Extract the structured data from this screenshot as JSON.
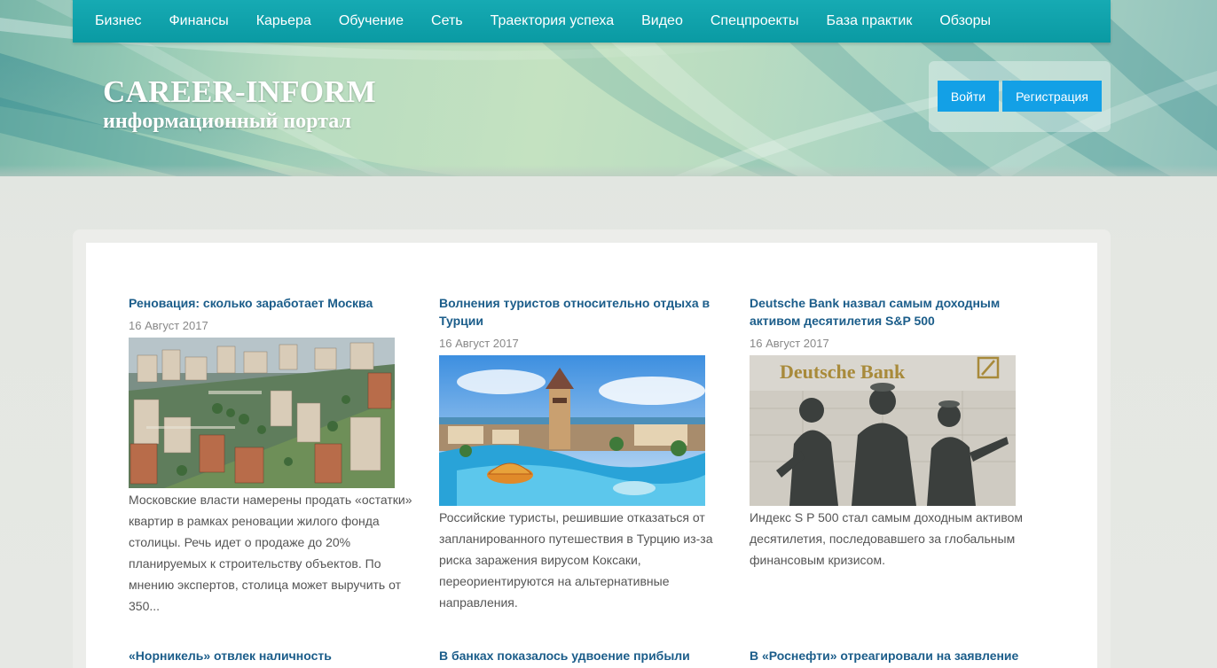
{
  "nav": {
    "items": [
      "Бизнес",
      "Финансы",
      "Карьера",
      "Обучение",
      "Сеть",
      "Траектория успеха",
      "Видео",
      "Спецпроекты",
      "База практик",
      "Обзоры"
    ]
  },
  "brand": {
    "title": "CAREER-INFORM",
    "subtitle": "информационный портал"
  },
  "auth": {
    "login_label": "Войти",
    "register_label": "Регистрация"
  },
  "colors": {
    "nav_bg": "#0a9aa3",
    "button_bg": "#13a0e6",
    "title_link": "#1b5d8a"
  },
  "articles": [
    {
      "title": "Реновация: сколько заработает Москва",
      "date": "16 Август 2017",
      "image": "model-city-image",
      "text": "Московские власти намерены продать «остатки» квартир в рамках реновации жилого фонда столицы. Речь идет о продаже до 20% планируемых к строительству объектов. По мнению экспертов, столица может выручить от 350..."
    },
    {
      "title": "Волнения туристов относительно отдыха в Турции",
      "date": "16 Август 2017",
      "image": "resort-pool-image",
      "text": "Российские туристы, решившие отказаться от запланированного путешествия в Турцию из-за риска заражения вирусом Коксаки, переориентируются на альтернативные направления."
    },
    {
      "title": "Deutsche Bank назвал самым доходным активом десятилетия S&P 500",
      "date": "16 Август 2017",
      "image": "deutsche-bank-statues-image",
      "image_sign": "Deutsche Bank",
      "text": "Индекс S P 500 стал самым доходным активом десятилетия, последовавшего за глобальным финансовым кризисом."
    }
  ],
  "next_titles": [
    "«Норникель» отвлек наличность",
    "В банках показалось удвоение прибыли",
    "В «Роснефти» отреагировали на заявление"
  ]
}
